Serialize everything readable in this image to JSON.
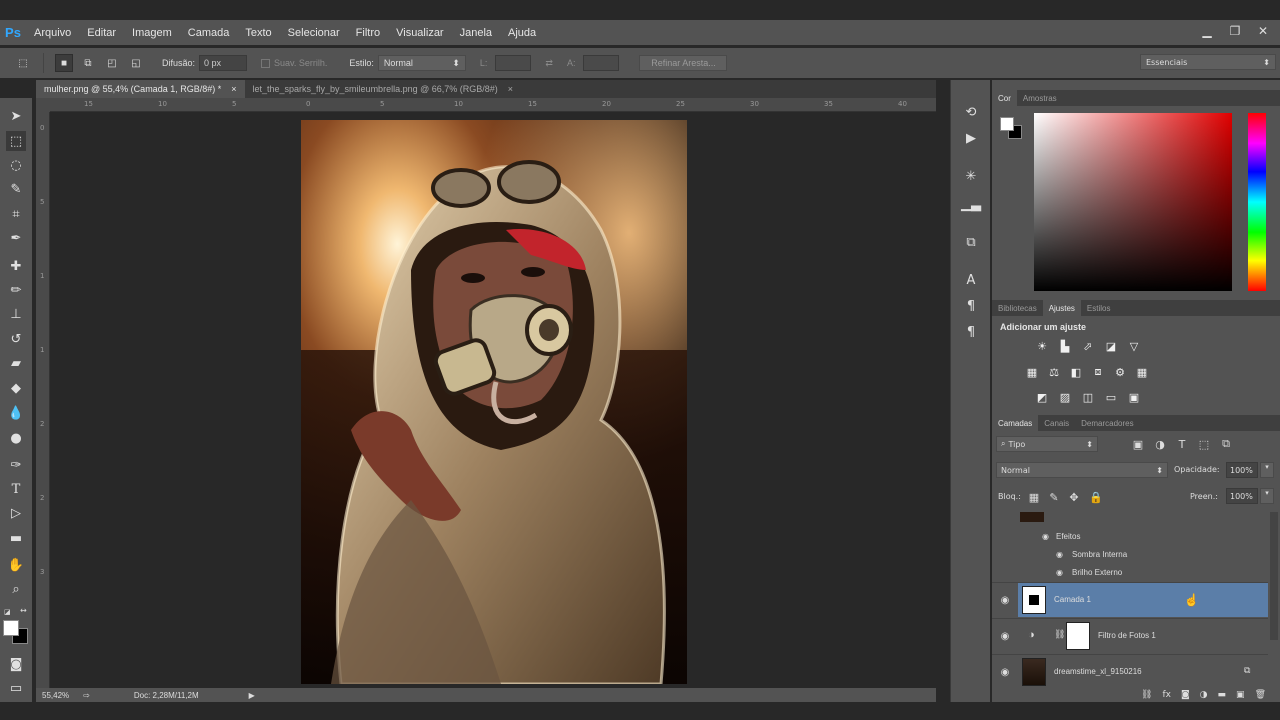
{
  "app": {
    "logo": "Ps"
  },
  "menu": [
    "Arquivo",
    "Editar",
    "Imagem",
    "Camada",
    "Texto",
    "Selecionar",
    "Filtro",
    "Visualizar",
    "Janela",
    "Ajuda"
  ],
  "window_controls": {
    "minimize": "▁",
    "restore": "❐",
    "close": "✕"
  },
  "options": {
    "feather_label": "Difusão:",
    "feather_value": "0 px",
    "antialias_label": "Suav. Serrilh.",
    "style_label": "Estilo:",
    "style_value": "Normal",
    "width_label": "L:",
    "height_label": "A:",
    "refine_edge": "Refinar Aresta...",
    "workspace": "Essenciais"
  },
  "tabs": [
    {
      "label": "mulher.png @ 55,4% (Camada 1, RGB/8#) *",
      "close": "×"
    },
    {
      "label": "let_the_sparks_fly_by_smileumbrella.png @ 66,7% (RGB/8#)",
      "close": "×"
    }
  ],
  "ruler": {
    "h": [
      "15",
      "10",
      "5",
      "0",
      "5",
      "10",
      "15",
      "20",
      "25",
      "30",
      "35",
      "40"
    ],
    "v": [
      "0",
      "5",
      "1",
      "1",
      "2",
      "2",
      "3"
    ]
  },
  "status": {
    "zoom": "55,42%",
    "doc": "Doc: 2,28M/11,2M"
  },
  "color_panel": {
    "tabs": [
      "Cor",
      "Amostras"
    ],
    "fg": "#ffffff",
    "bg": "#000000"
  },
  "adjust_panel": {
    "tabs": [
      "Bibliotecas",
      "Ajustes",
      "Estilos"
    ],
    "title": "Adicionar um ajuste"
  },
  "layers_panel": {
    "tabs": [
      "Camadas",
      "Canais",
      "Demarcadores"
    ],
    "filter": "Tipo",
    "blend": "Normal",
    "opacity_label": "Opacidade:",
    "opacity_value": "100%",
    "lock_label": "Bloq.:",
    "fill_label": "Preen.:",
    "fill_value": "100%",
    "effects_label": "Efeitos",
    "effect1": "Sombra Interna",
    "effect2": "Brilho Externo",
    "layer1": "Camada 1",
    "layer2": "Filtro de Fotos 1",
    "layer3": "dreamstime_xl_9150216"
  }
}
